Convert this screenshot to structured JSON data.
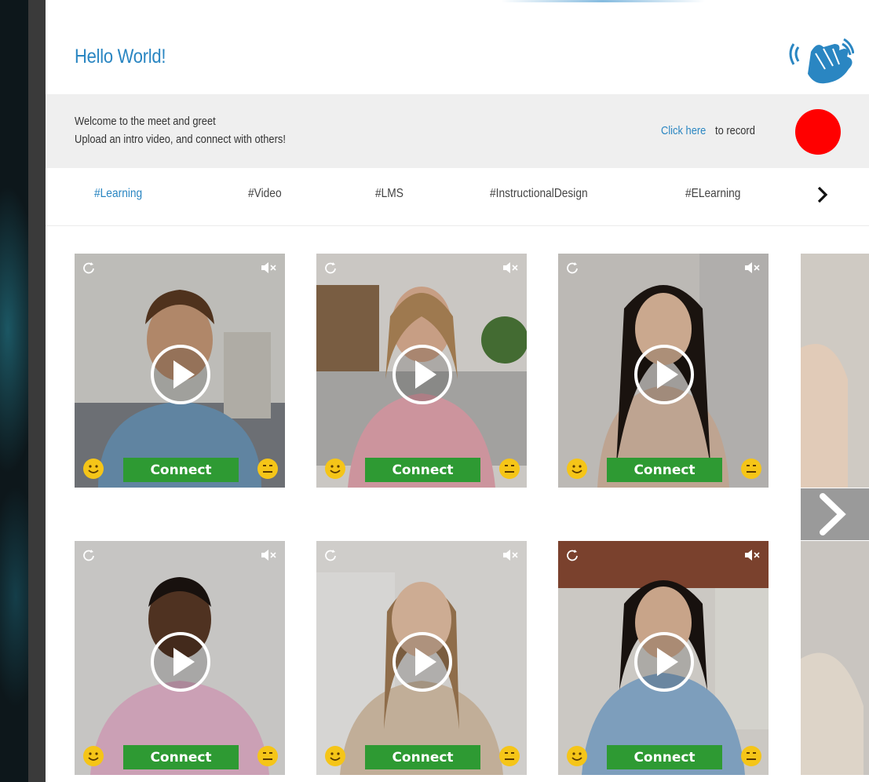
{
  "header": {
    "title": "Hello World!",
    "wave_icon": "waving-hand-icon"
  },
  "welcome": {
    "line1": "Welcome to the meet and greet",
    "line2": "Upload an intro video, and connect with others!",
    "record_link": "Click here",
    "record_rest": "to record",
    "record_color": "#ff0000"
  },
  "tags": {
    "items": [
      {
        "label": "#Learning",
        "active": true
      },
      {
        "label": "#Video",
        "active": false
      },
      {
        "label": "#LMS",
        "active": false
      },
      {
        "label": "#InstructionalDesign",
        "active": false
      },
      {
        "label": "#ELearning",
        "active": false
      }
    ],
    "next_icon": "chevron-right-icon"
  },
  "cards": [
    {
      "connect_label": "Connect"
    },
    {
      "connect_label": "Connect"
    },
    {
      "connect_label": "Connect"
    },
    {
      "connect_label": "Connect"
    },
    {
      "connect_label": "Connect"
    },
    {
      "connect_label": "Connect"
    }
  ],
  "colors": {
    "accent": "#2a86c2",
    "connect": "#2e9a33",
    "panel": "#ffffff",
    "welcome_bar": "#efefef"
  }
}
